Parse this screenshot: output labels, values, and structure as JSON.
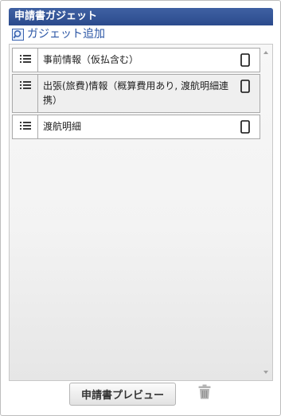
{
  "header": {
    "title": "申請書ガジェット"
  },
  "add_gadget": {
    "icon": "search-icon",
    "label": "ガジェット追加"
  },
  "gadget_list": {
    "items": [
      {
        "label": "事前情報（仮払含む）",
        "handle_icon": "drag-handle-icon",
        "status_icon": "mobile-phone-icon"
      },
      {
        "label": "出張(旅費)情報（概算費用あり, 渡航明細連携）",
        "handle_icon": "drag-handle-icon",
        "status_icon": "mobile-phone-icon"
      },
      {
        "label": "渡航明細",
        "handle_icon": "drag-handle-icon",
        "status_icon": "mobile-phone-icon"
      }
    ]
  },
  "footer": {
    "preview_label": "申請書プレビュー",
    "trash_icon": "trash-icon"
  },
  "colors": {
    "header_bg": "#2f4f90",
    "link": "#2a55a5"
  }
}
